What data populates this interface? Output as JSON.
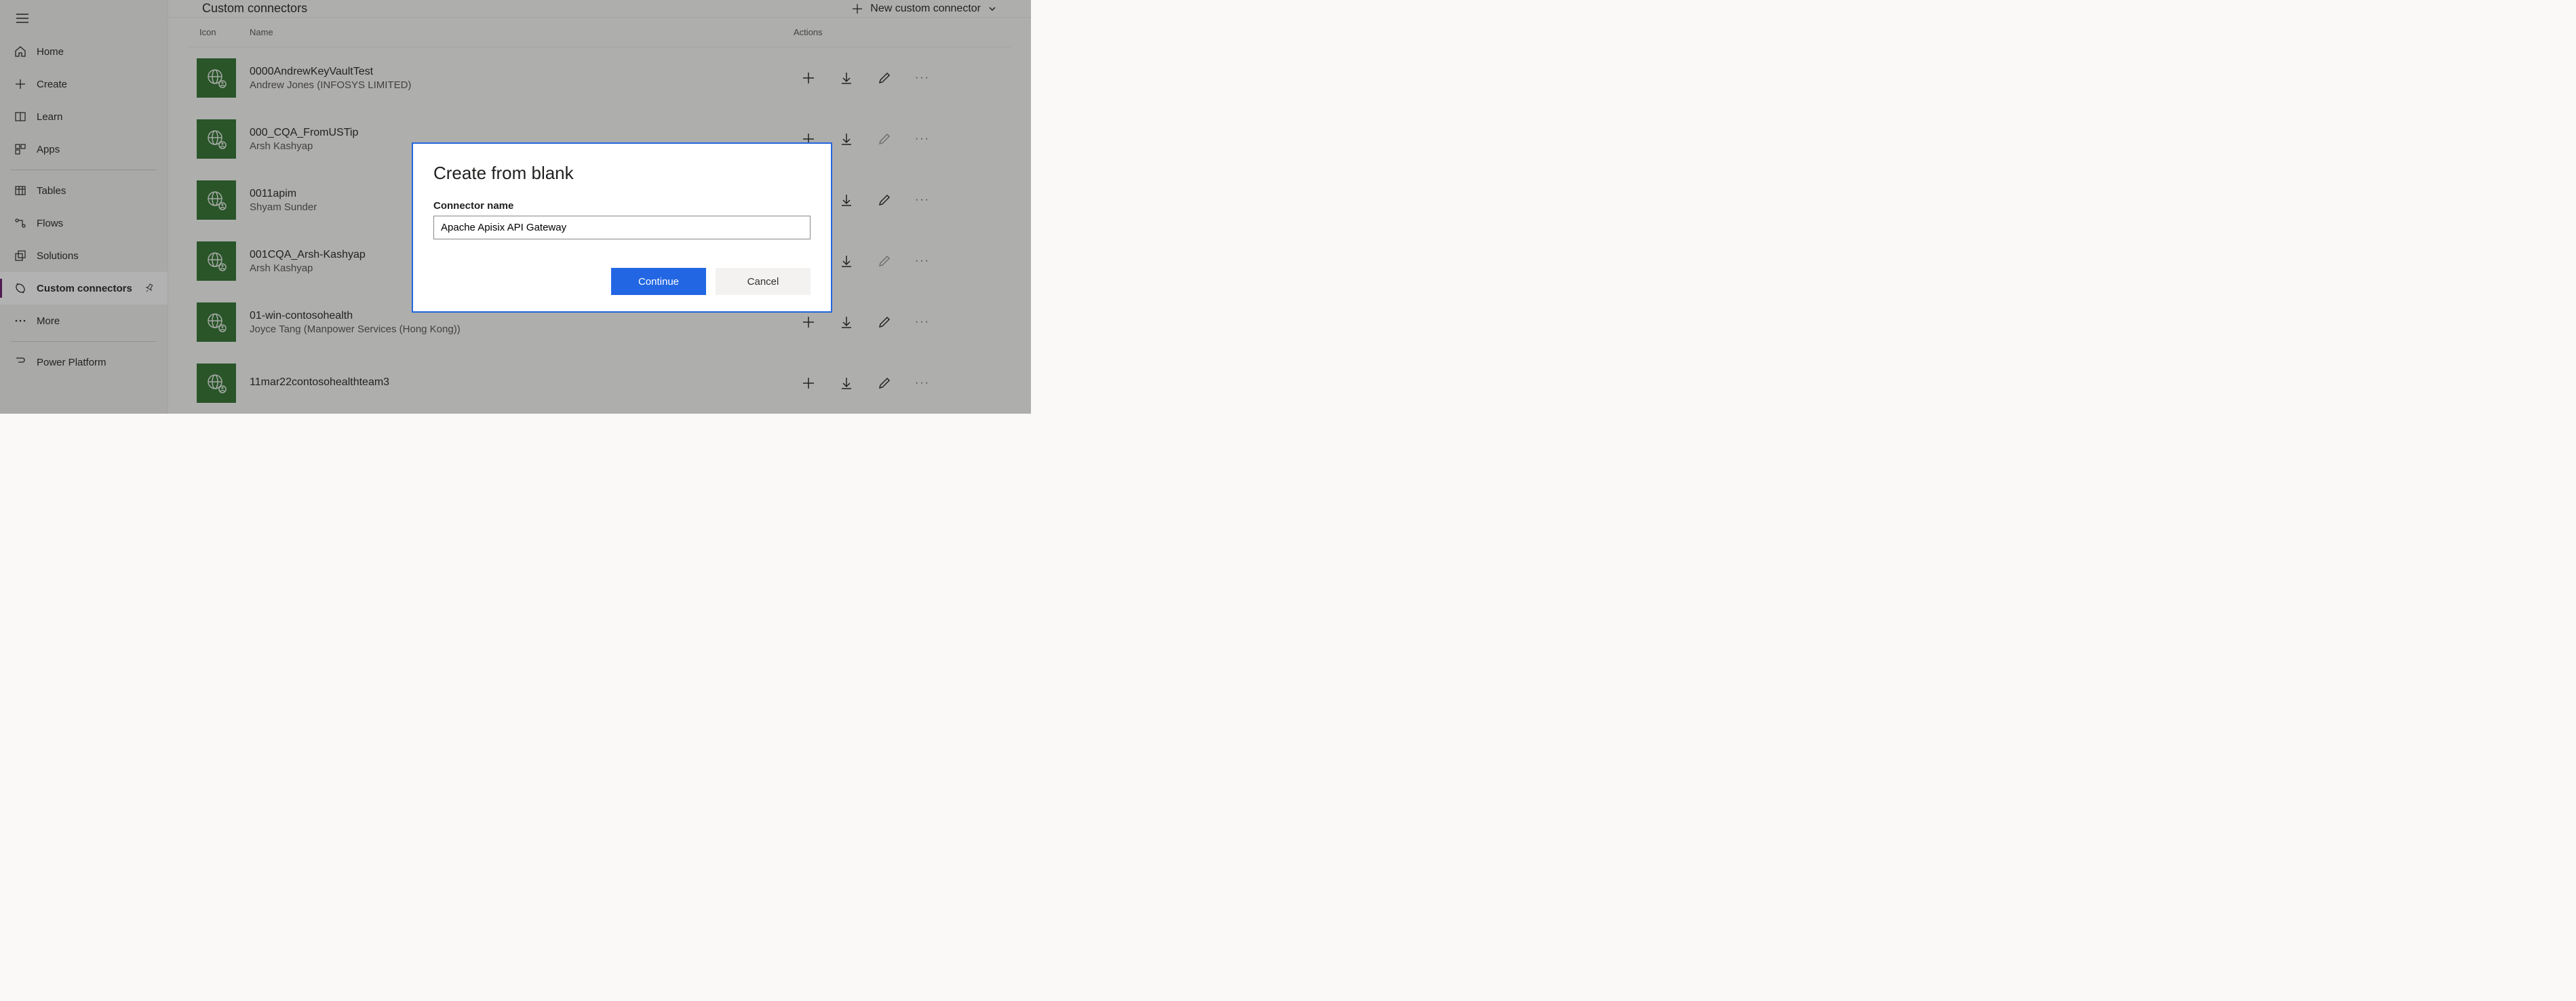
{
  "sidebar": {
    "items": [
      {
        "id": "home",
        "label": "Home"
      },
      {
        "id": "create",
        "label": "Create"
      },
      {
        "id": "learn",
        "label": "Learn"
      },
      {
        "id": "apps",
        "label": "Apps"
      },
      {
        "id": "tables",
        "label": "Tables"
      },
      {
        "id": "flows",
        "label": "Flows"
      },
      {
        "id": "solutions",
        "label": "Solutions"
      },
      {
        "id": "custom-connectors",
        "label": "Custom connectors"
      },
      {
        "id": "more",
        "label": "More"
      },
      {
        "id": "power-platform",
        "label": "Power Platform"
      }
    ]
  },
  "header": {
    "title": "Custom connectors",
    "new_button": "New custom connector"
  },
  "table": {
    "columns": {
      "icon": "Icon",
      "name": "Name",
      "actions": "Actions"
    },
    "rows": [
      {
        "name": "0000AndrewKeyVaultTest",
        "owner": "Andrew Jones (INFOSYS LIMITED)",
        "edit_disabled": false
      },
      {
        "name": "000_CQA_FromUSTip",
        "owner": "Arsh Kashyap",
        "edit_disabled": true
      },
      {
        "name": "0011apim",
        "owner": "Shyam Sunder",
        "edit_disabled": false
      },
      {
        "name": "001CQA_Arsh-Kashyap",
        "owner": "Arsh Kashyap",
        "edit_disabled": true
      },
      {
        "name": "01-win-contosohealth",
        "owner": "Joyce Tang (Manpower Services (Hong Kong))",
        "edit_disabled": false
      },
      {
        "name": "11mar22contosohealthteam3",
        "owner": "",
        "edit_disabled": false
      }
    ]
  },
  "dialog": {
    "title": "Create from blank",
    "field_label": "Connector name",
    "field_value": "Apache Apisix API Gateway",
    "continue": "Continue",
    "cancel": "Cancel"
  }
}
